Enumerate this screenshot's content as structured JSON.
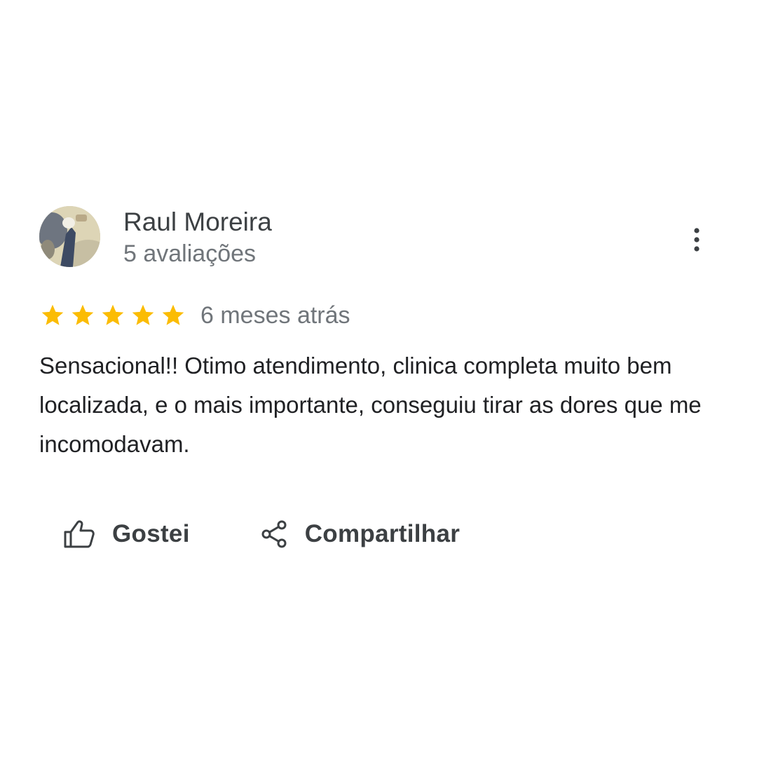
{
  "review": {
    "reviewer": {
      "name": "Raul Moreira",
      "review_count": "5 avaliações",
      "avatar_icon": "user-photo-avatar"
    },
    "rating": {
      "stars": 5,
      "max_stars": 5,
      "star_color": "#fbbc04"
    },
    "date": "6 meses atrás",
    "text": "Sensacional!! Otimo atendimento, clinica completa muito bem localizada, e o mais importante, conseguiu tirar as dores que me incomodavam.",
    "more_icon": "more-vert-icon"
  },
  "actions": {
    "like_label": "Gostei",
    "like_icon": "thumbs-up-icon",
    "share_label": "Compartilhar",
    "share_icon": "share-icon"
  },
  "colors": {
    "text_primary": "#202124",
    "text_name": "#3c4043",
    "text_secondary": "#70757a",
    "icon": "#3c4043",
    "background": "#ffffff"
  }
}
